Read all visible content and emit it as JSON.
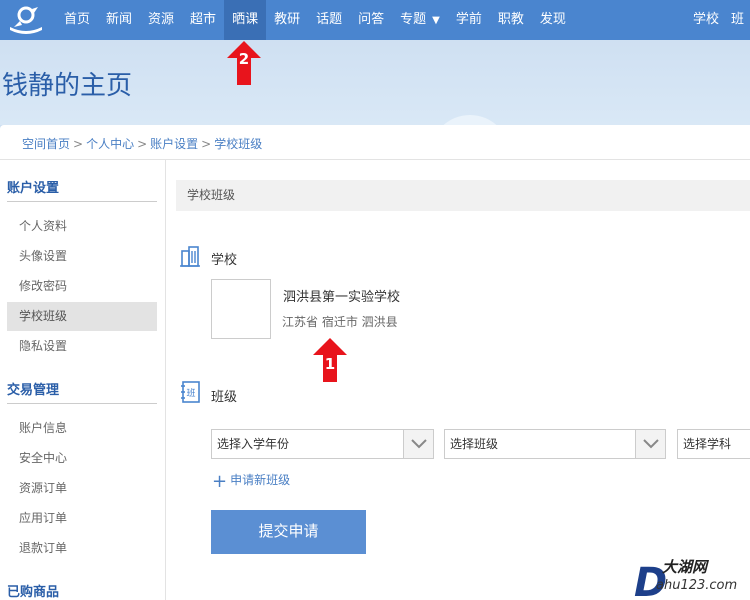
{
  "nav": {
    "items": [
      "首页",
      "新闻",
      "资源",
      "超市",
      "晒课",
      "教研",
      "话题",
      "问答",
      "专题",
      "学前",
      "职教",
      "发现"
    ],
    "active_index": 4,
    "right_items": [
      "学校",
      "班"
    ]
  },
  "page_title": "钱静的主页",
  "breadcrumb": [
    "空间首页",
    "个人中心",
    "账户设置",
    "学校班级"
  ],
  "breadcrumb_sep": ">",
  "sidebar": {
    "groups": [
      {
        "title": "账户设置",
        "items": [
          "个人资料",
          "头像设置",
          "修改密码",
          "学校班级",
          "隐私设置"
        ]
      },
      {
        "title": "交易管理",
        "items": [
          "账户信息",
          "安全中心",
          "资源订单",
          "应用订单",
          "退款订单"
        ]
      },
      {
        "title": "已购商品",
        "items": []
      }
    ],
    "active_item": "学校班级"
  },
  "main": {
    "section_title": "学校班级",
    "school_heading": "学校",
    "school_name": "泗洪县第一实验学校",
    "school_location": "江苏省 宿迁市 泗洪县",
    "class_heading": "班级",
    "class_icon_text": "班",
    "selects": [
      "选择入学年份",
      "选择班级",
      "选择学科"
    ],
    "add_class_label": "申请新班级",
    "submit_label": "提交申请"
  },
  "annotations": [
    "1",
    "2"
  ],
  "watermark": {
    "line1": "大湖网",
    "line2": "ahu123.com",
    "letter": "D"
  },
  "colors": {
    "nav_bg": "#4a85cf",
    "accent": "#2a5ea8",
    "button": "#5b8fd3",
    "marker": "#e8141c"
  }
}
